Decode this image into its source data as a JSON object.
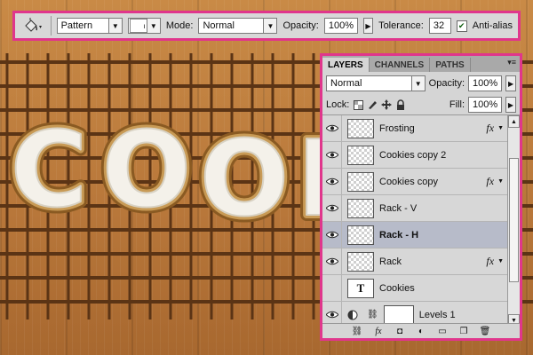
{
  "options_bar": {
    "tool_icon": "paint-bucket-icon",
    "fill_source": "Pattern",
    "mode_label": "Mode:",
    "mode_value": "Normal",
    "opacity_label": "Opacity:",
    "opacity_value": "100%",
    "tolerance_label": "Tolerance:",
    "tolerance_value": "32",
    "antialias_label": "Anti-alias",
    "antialias_checked": true
  },
  "layers_panel": {
    "tabs": [
      {
        "label": "LAYERS",
        "active": true
      },
      {
        "label": "CHANNELS",
        "active": false
      },
      {
        "label": "PATHS",
        "active": false
      }
    ],
    "blend_mode": "Normal",
    "opacity_label": "Opacity:",
    "opacity_value": "100%",
    "lock_label": "Lock:",
    "fill_label": "Fill:",
    "fill_value": "100%",
    "layers": [
      {
        "name": "Frosting",
        "visible": true,
        "fx": true,
        "thumb": "pattern"
      },
      {
        "name": "Cookies copy 2",
        "visible": true,
        "fx": false,
        "thumb": "pattern"
      },
      {
        "name": "Cookies copy",
        "visible": true,
        "fx": true,
        "thumb": "pattern"
      },
      {
        "name": "Rack - V",
        "visible": true,
        "fx": false,
        "thumb": "pattern"
      },
      {
        "name": "Rack - H",
        "visible": true,
        "fx": false,
        "thumb": "pattern",
        "selected": true
      },
      {
        "name": "Rack",
        "visible": true,
        "fx": true,
        "thumb": "pattern"
      },
      {
        "name": "Cookies",
        "visible": false,
        "fx": false,
        "thumb": "text",
        "thumb_text": "T"
      },
      {
        "name": "Levels 1",
        "visible": true,
        "fx": false,
        "thumb": "adjustment"
      }
    ],
    "fx_label": "fx",
    "footer_icons": [
      "link-icon",
      "fx-icon",
      "mask-icon",
      "adjustment-icon",
      "folder-icon",
      "new-layer-icon",
      "trash-icon"
    ]
  },
  "canvas": {
    "text": "COOK",
    "colors": {
      "wood": "#b8773a",
      "rack": "#5b3415",
      "frosting": "#f4f1ea",
      "cookie": "#c89a55"
    }
  },
  "colors": {
    "highlight_border": "#e0368c",
    "selected_row": "#b7bbc9"
  }
}
